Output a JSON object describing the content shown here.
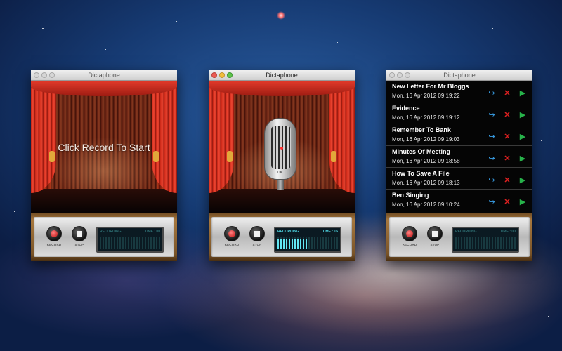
{
  "windows": [
    {
      "title": "Dictaphone",
      "stage_text": "Click Record To Start",
      "controls": {
        "record_label": "RECORD",
        "stop_label": "STOP"
      },
      "display": {
        "status": "RECORDING",
        "time_label": "TIME : 00"
      }
    },
    {
      "title": "Dictaphone",
      "microphone_badge": "DK",
      "controls": {
        "record_label": "RECORD",
        "stop_label": "STOP"
      },
      "display": {
        "status": "RECORDING",
        "time_label": "TIME : 16"
      }
    },
    {
      "title": "Dictaphone",
      "recordings": [
        {
          "title": "New Letter For Mr Bloggs",
          "date": "Mon, 16 Apr 2012 09:19:22"
        },
        {
          "title": "Evidence",
          "date": "Mon, 16 Apr 2012 09:19:12"
        },
        {
          "title": "Remember To Bank",
          "date": "Mon, 16 Apr 2012 09:19:03"
        },
        {
          "title": "Minutes Of Meeting",
          "date": "Mon, 16 Apr 2012 09:18:58"
        },
        {
          "title": "How To Save A File",
          "date": "Mon, 16 Apr 2012 09:18:13"
        },
        {
          "title": "Ben Singing",
          "date": "Mon, 16 Apr 2012 09:10:24"
        }
      ],
      "controls": {
        "record_label": "RECORD",
        "stop_label": "STOP"
      },
      "display": {
        "status": "RECORDING",
        "time_label": "TIME : 00"
      }
    }
  ],
  "icons": {
    "share": "share-arrow-icon",
    "delete": "delete-x-icon",
    "play": "play-triangle-icon"
  },
  "colors": {
    "curtain": "#c82616",
    "lcd_active": "#4fd9e6",
    "play": "#27b24a",
    "delete": "#e02020",
    "share": "#3aa0e8"
  }
}
